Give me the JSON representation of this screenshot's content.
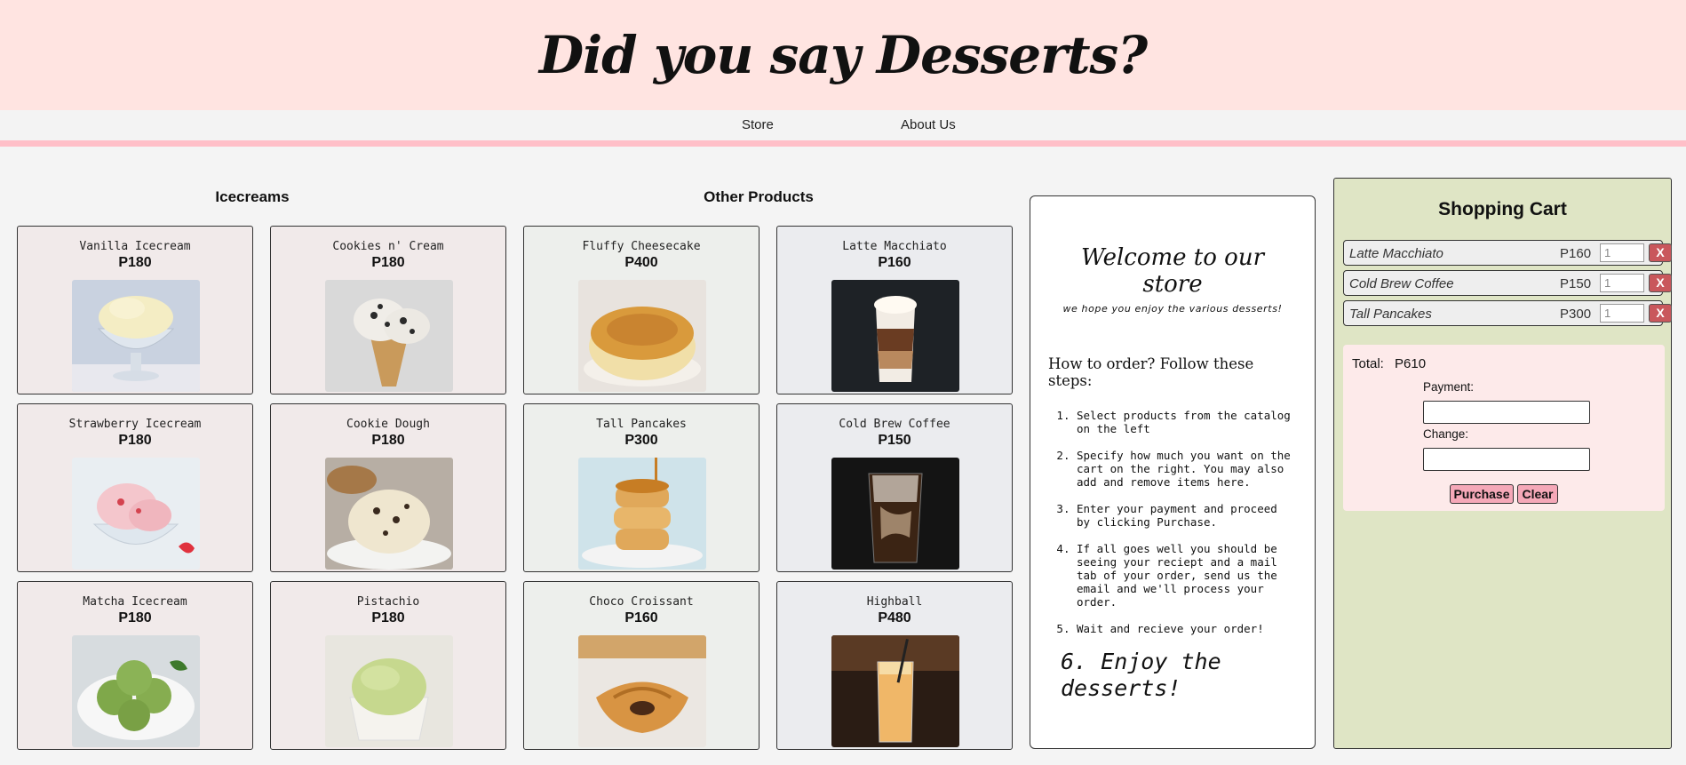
{
  "header": {
    "title": "Did you say Desserts?"
  },
  "nav": {
    "items": [
      {
        "label": "Store"
      },
      {
        "label": "About Us"
      }
    ]
  },
  "sections": {
    "icecreams_title": "Icecreams",
    "other_title": "Other Products"
  },
  "products": [
    {
      "name": "Vanilla Icecream",
      "price": "P180",
      "image": "vanilla-icecream"
    },
    {
      "name": "Cookies n' Cream",
      "price": "P180",
      "image": "cookies-n-cream"
    },
    {
      "name": "Fluffy Cheesecake",
      "price": "P400",
      "image": "fluffy-cheesecake"
    },
    {
      "name": "Latte Macchiato",
      "price": "P160",
      "image": "latte-macchiato"
    },
    {
      "name": "Strawberry Icecream",
      "price": "P180",
      "image": "strawberry-icecream"
    },
    {
      "name": "Cookie Dough",
      "price": "P180",
      "image": "cookie-dough"
    },
    {
      "name": "Tall Pancakes",
      "price": "P300",
      "image": "tall-pancakes"
    },
    {
      "name": "Cold Brew Coffee",
      "price": "P150",
      "image": "cold-brew-coffee"
    },
    {
      "name": "Matcha Icecream",
      "price": "P180",
      "image": "matcha-icecream"
    },
    {
      "name": "Pistachio",
      "price": "P180",
      "image": "pistachio"
    },
    {
      "name": "Choco Croissant",
      "price": "P160",
      "image": "choco-croissant"
    },
    {
      "name": "Highball",
      "price": "P480",
      "image": "highball"
    }
  ],
  "welcome": {
    "title": "Welcome to our store",
    "subtitle": "we hope you enjoy the various desserts!",
    "howto": "How to order? Follow these steps:",
    "steps": [
      "Select products from the catalog on the left",
      "Specify how much you want on the cart on the right. You may also add and remove items here.",
      "Enter your payment and proceed by clicking Purchase.",
      "If all goes well you should be seeing your reciept and a mail tab of your order, send us the email and we'll process your order.",
      "Wait and recieve your order!"
    ],
    "final_step": "6. Enjoy the desserts!"
  },
  "cart": {
    "title": "Shopping Cart",
    "items": [
      {
        "name": "Latte Macchiato",
        "price": "P160",
        "qty": "1",
        "remove_label": "X"
      },
      {
        "name": "Cold Brew Coffee",
        "price": "P150",
        "qty": "1",
        "remove_label": "X"
      },
      {
        "name": "Tall Pancakes",
        "price": "P300",
        "qty": "1",
        "remove_label": "X"
      }
    ],
    "total_label": "Total:",
    "total_value": "P610",
    "payment_label": "Payment:",
    "payment_value": "",
    "change_label": "Change:",
    "change_value": "",
    "purchase_label": "Purchase",
    "clear_label": "Clear"
  },
  "colors": {
    "header_bg": "#ffe4e1",
    "nav_border": "#ffbfc8",
    "cart_bg": "#dfe5c5",
    "checkout_bg": "#fdeaea",
    "button_bg": "#f5a8b8",
    "remove_bg": "#c9575c"
  }
}
